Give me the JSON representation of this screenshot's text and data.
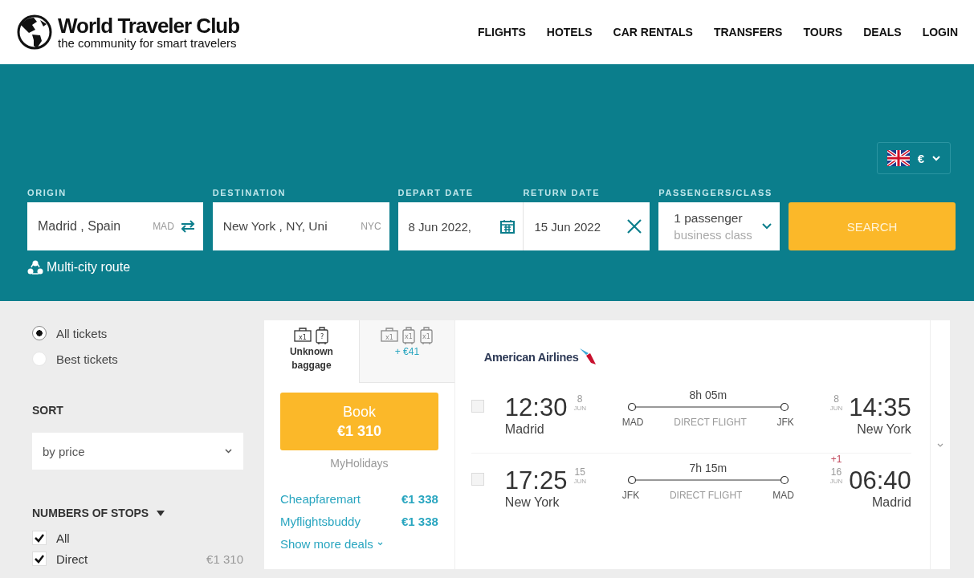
{
  "header": {
    "logo": {
      "title": "World Traveler Club",
      "tagline": "the community for smart travelers"
    },
    "nav": [
      {
        "label": "FLIGHTS"
      },
      {
        "label": "HOTELS"
      },
      {
        "label": "CAR RENTALS"
      },
      {
        "label": "TRANSFERS"
      },
      {
        "label": "TOURS"
      },
      {
        "label": "DEALS"
      },
      {
        "label": "LOGIN"
      }
    ]
  },
  "search": {
    "currency": "€",
    "origin": {
      "label": "ORIGIN",
      "value": "Madrid , Spain",
      "code": "MAD"
    },
    "destination": {
      "label": "DESTINATION",
      "value": "New York , NY, Uni",
      "code": "NYC"
    },
    "depart": {
      "label": "DEPART DATE",
      "value": "8 Jun 2022,"
    },
    "return": {
      "label": "RETURN DATE",
      "value": "15 Jun 2022"
    },
    "passengers": {
      "label": "PASSENGERS/CLASS",
      "value": "1 passenger",
      "class": "business class"
    },
    "search_button": "SEARCH",
    "multi_city": "Multi-city route"
  },
  "filters": {
    "ticket_types": [
      {
        "label": "All tickets",
        "selected": true
      },
      {
        "label": "Best tickets",
        "selected": false
      }
    ],
    "sort": {
      "title": "SORT",
      "value": "by price"
    },
    "stops": {
      "title": "NUMBERS OF STOPS",
      "options": [
        {
          "label": "All",
          "checked": true
        },
        {
          "label": "Direct",
          "checked": true,
          "price": "€1 310"
        }
      ]
    }
  },
  "result": {
    "baggage_tabs": [
      {
        "selected": true,
        "icons": [
          {
            "kind": "bag",
            "mark": "x1"
          },
          {
            "kind": "suitcase",
            "mark": "?"
          }
        ],
        "label": "Unknown baggage"
      },
      {
        "selected": false,
        "icons": [
          {
            "kind": "bag",
            "mark": "x1"
          },
          {
            "kind": "suitcase",
            "mark": "x1"
          },
          {
            "kind": "suitcase",
            "mark": "x1"
          }
        ],
        "label": "+ €41"
      }
    ],
    "book": {
      "label": "Book",
      "price": "€1 310"
    },
    "agency": "MyHolidays",
    "deals": [
      {
        "name": "Cheapfaremart",
        "price": "€1 338"
      },
      {
        "name": "Myflightsbuddy",
        "price": "€1 338"
      }
    ],
    "more_deals": "Show more deals",
    "airline": "American Airlines",
    "segments": [
      {
        "checked": false,
        "dep_time": "12:30",
        "dep_day": "8",
        "dep_month": "JUN",
        "dep_city": "Madrid",
        "duration": "8h 05m",
        "from": "MAD",
        "type": "DIRECT FLIGHT",
        "to": "JFK",
        "arr_day": "8",
        "arr_month": "JUN",
        "arr_time": "14:35",
        "arr_city": "New York"
      },
      {
        "checked": false,
        "dep_time": "17:25",
        "dep_day": "15",
        "dep_month": "JUN",
        "dep_city": "New York",
        "duration": "7h 15m",
        "from": "JFK",
        "type": "DIRECT FLIGHT",
        "to": "MAD",
        "day_offset": "+1",
        "arr_day": "16",
        "arr_month": "JUN",
        "arr_time": "06:40",
        "arr_city": "Madrid"
      }
    ]
  }
}
